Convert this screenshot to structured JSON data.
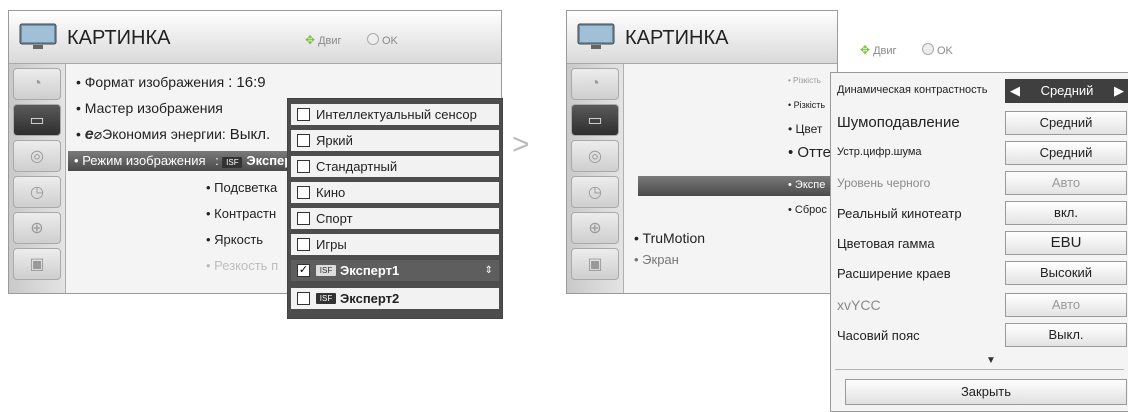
{
  "left": {
    "title": "КАРТИНКА",
    "hint_move": "Двиг",
    "hint_ok": "OK",
    "items": {
      "format": "• Формат изображения",
      "format_sep": ":",
      "format_value": "16:9",
      "master": "• Мастер изображения",
      "energy_bullet": "•",
      "energy_logo": "e",
      "energy_label": "Экономия энергии:",
      "energy_value": "Выкл.",
      "mode_bullet": "•",
      "mode": "Режим изображения",
      "mode_sep": ":",
      "mode_value": "Экспер",
      "backlight": "• Подсветка",
      "contrast": "• Контрастн",
      "brightness": "• Яркость",
      "sharpness": "• Резкость п"
    },
    "dropdown": [
      {
        "label": "Интеллектуальный сенсор",
        "checked": false
      },
      {
        "label": "Яркий",
        "checked": false
      },
      {
        "label": "Стандартный",
        "checked": false
      },
      {
        "label": "Кино",
        "checked": false
      },
      {
        "label": "Спорт",
        "checked": false
      },
      {
        "label": "Игры",
        "checked": false
      },
      {
        "label": "Эксперт1",
        "checked": true
      },
      {
        "label": "Эксперт2",
        "checked": false
      }
    ]
  },
  "arrow": ">",
  "right": {
    "title": "КАРТИНКА",
    "hint_move": "Двиг",
    "hint_ok": "OK",
    "items": {
      "r1": "• Різкість",
      "r2": "• Різкість",
      "r3": "• Цвет",
      "r4": "• Отте",
      "r5": "• Экспе",
      "r6": "• Сброс",
      "trumotion": "• TruMotion",
      "screen": "• Экран"
    },
    "settings": [
      {
        "label": "Динамическая контрастность",
        "value": "Средний",
        "active": true
      },
      {
        "label": "Шумоподавление",
        "value": "Средний"
      },
      {
        "label": "Устр.цифр.шума",
        "value": "Средний"
      },
      {
        "label": "Уровень черного",
        "value": "Авто",
        "dim": true
      },
      {
        "label": "Реальный кинотеатр",
        "value": "вкл."
      },
      {
        "label": "Цветовая гамма",
        "value": "EBU"
      },
      {
        "label": "Расширение краев",
        "value": "Высокий"
      },
      {
        "label": "xvYCC",
        "value": "Авто",
        "dim": true
      },
      {
        "label": "Часовий пояс",
        "value": "Выкл."
      }
    ],
    "close_label": "Закрыть",
    "left_arrow": "◀",
    "right_arrow": "▶",
    "down_arrow": "▼"
  }
}
